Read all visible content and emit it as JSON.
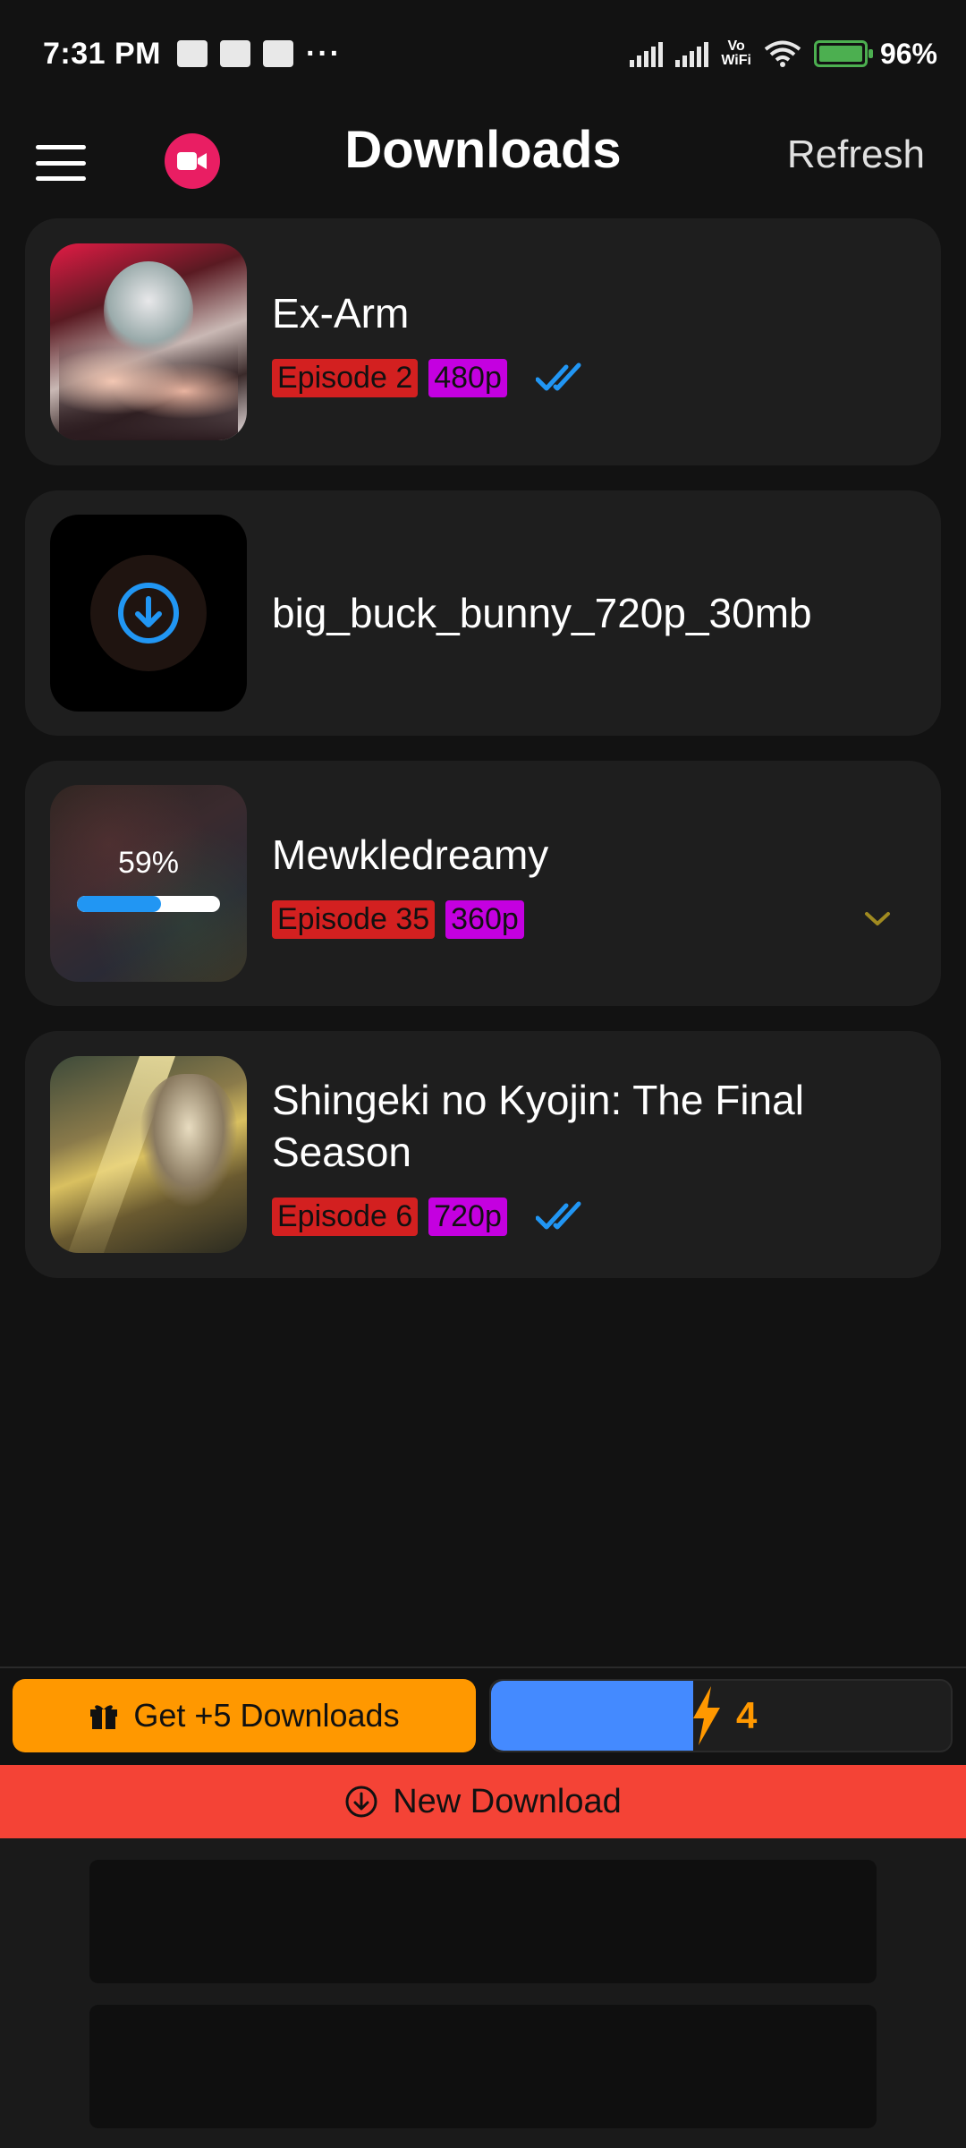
{
  "status_bar": {
    "time": "7:31 PM",
    "dots": "···",
    "vowifi_top": "Vo",
    "vowifi_bottom": "WiFi",
    "battery": "96%"
  },
  "header": {
    "title": "Downloads",
    "refresh_label": "Refresh"
  },
  "downloads": [
    {
      "title": "Ex-Arm",
      "episode": "Episode 2",
      "quality": "480p",
      "status": "completed"
    },
    {
      "title": "big_buck_bunny_720p_30mb",
      "status": "queued"
    },
    {
      "title": "Mewkledreamy",
      "episode": "Episode 35",
      "quality": "360p",
      "status": "downloading",
      "progress_label": "59%",
      "progress": 0.59
    },
    {
      "title": "Shingeki no Kyojin: The Final Season",
      "episode": "Episode 6",
      "quality": "720p",
      "status": "completed"
    }
  ],
  "bottom": {
    "get_downloads_label": "Get +5 Downloads",
    "credits_count": "4",
    "credits_fill": 0.44,
    "new_download_label": "New Download"
  },
  "colors": {
    "accent_pink": "#e91e63",
    "episode_tag": "#d32020",
    "quality_tag": "#c400e0",
    "orange": "#ff9800",
    "blue": "#448aff",
    "red": "#f44336"
  }
}
